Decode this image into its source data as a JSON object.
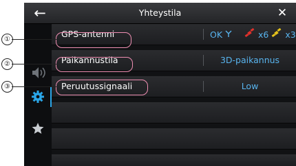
{
  "header": {
    "back_icon": "arrow-left-icon",
    "title": "Yhteystila",
    "close_icon": "close-x-icon"
  },
  "sidebar": {
    "items": [
      {
        "name": "speaker-icon"
      },
      {
        "name": "gear-icon",
        "active": true
      },
      {
        "name": "star-icon"
      }
    ]
  },
  "rows": [
    {
      "label": "GPS-antenni",
      "status_text": "OK",
      "satellites_used": "x6",
      "satellites_tracked": "x3"
    },
    {
      "label": "Paikannustila",
      "value": "3D-paikannus"
    },
    {
      "label": "Peruutussignaali",
      "value": "Low"
    }
  ],
  "callouts": [
    {
      "number": "①"
    },
    {
      "number": "②"
    },
    {
      "number": "③"
    }
  ],
  "colors": {
    "accent": "#58b4ee",
    "callout_outline": "#ef8fb3",
    "satellite_red": "#e0312b",
    "satellite_yellow": "#e5c21b"
  }
}
